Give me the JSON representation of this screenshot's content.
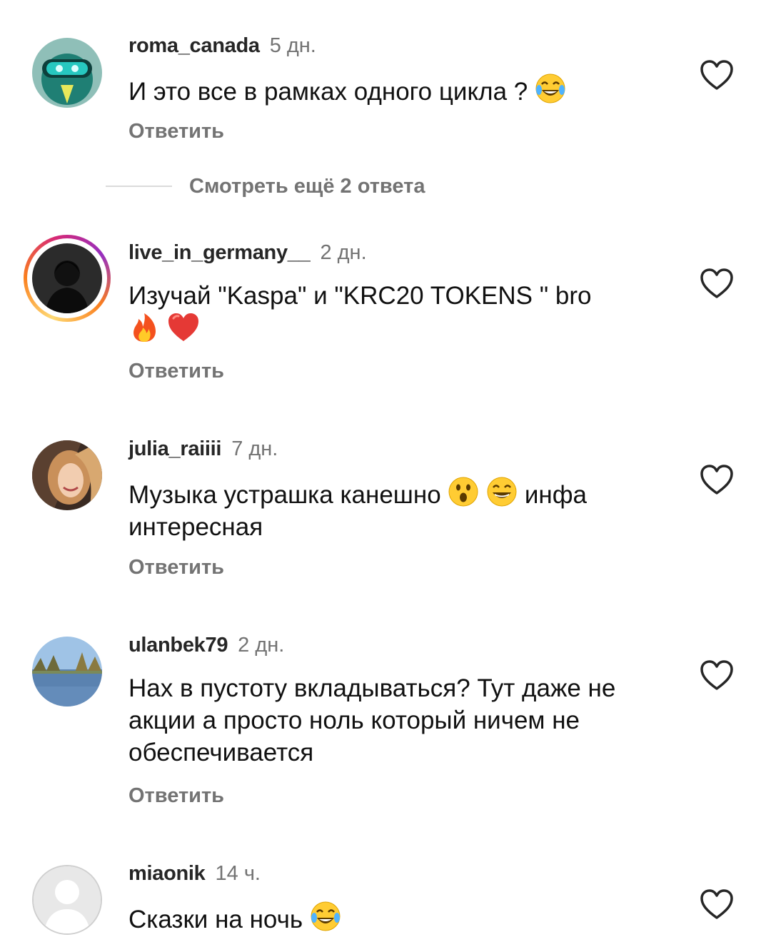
{
  "comments": [
    {
      "username": "roma_canada",
      "time": "5 дн.",
      "text": "И это все в рамках одного цикла ?",
      "emoji": [
        "joy"
      ],
      "reply_label": "Ответить",
      "liked": false
    },
    {
      "username": "live_in_germany__",
      "time": "2 дн.",
      "text": "Изучай \"Kaspa\" и \"KRC20 TOKENS \" bro",
      "emoji": [
        "fire",
        "red-heart"
      ],
      "reply_label": "Ответить",
      "liked": false,
      "has_story": true
    },
    {
      "username": "julia_raiiii",
      "time": "7 дн.",
      "text_part1": "Музыка устрашка канешно",
      "text_part2": "инфа интересная",
      "emoji": [
        "astonished",
        "grin"
      ],
      "reply_label": "Ответить",
      "liked": false
    },
    {
      "username": "ulanbek79",
      "time": "2 дн.",
      "text": "Нах в пустоту вкладываться? Тут даже не акции а просто ноль который ничем не обеспечивается",
      "reply_label": "Ответить",
      "liked": false
    },
    {
      "username": "miaonik",
      "time": "14 ч.",
      "text": "Сказки на ночь",
      "emoji": [
        "joy"
      ],
      "liked": false
    }
  ],
  "more_replies_label": "Смотреть ещё 2 ответа",
  "colors": {
    "username": "#262626",
    "secondary": "#737373",
    "divider": "#dbdbdb"
  },
  "icons": [
    "heart-outline-icon"
  ]
}
